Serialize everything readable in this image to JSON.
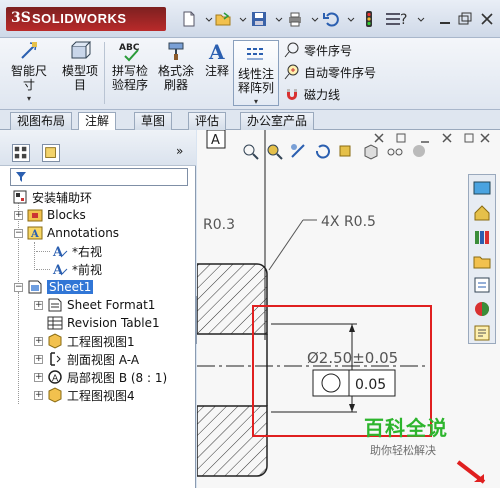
{
  "app": {
    "brand_ds": "3S",
    "brand_name": "SOLIDWORKS"
  },
  "ribbon": {
    "smart_dim_label": "智能尺寸",
    "model_items_label": "模型项目",
    "spell_check_label": "拼写检验程序",
    "format_painter_label": "格式涂刷器",
    "note_label": "注释",
    "linear_note_label": "线性注释阵列",
    "balloon_label": "零件序号",
    "auto_balloon_label": "自动零件序号",
    "magnetic_line_label": "磁力线",
    "abc_glyph": "ABC",
    "note_glyph": "A"
  },
  "tabs": [
    "视图布局",
    "注解",
    "草图",
    "评估",
    "办公室产品"
  ],
  "tabs_active_index": 1,
  "tree": {
    "root": "安装辅助环",
    "blocks": "Blocks",
    "annotations": "Annotations",
    "right_view": "*右视",
    "front_view": "*前视",
    "sheet1": "Sheet1",
    "sheet_format": "Sheet Format1",
    "revision_table": "Revision Table1",
    "drawing_view1": "工程图视图1",
    "section_view": "剖面视图 A-A",
    "detail_view": "局部视图 B (8 : 1)",
    "drawing_view4": "工程图视图4"
  },
  "drawing": {
    "r03": "R0.3",
    "r05": "4X R0.5",
    "diameter": "Ø2.50±0.05",
    "tolerance": "0.05",
    "datum": "A"
  },
  "watermark": {
    "title": "百科全说",
    "subtitle": "助你轻松解决"
  },
  "colors": {
    "accent": "#3176d6",
    "watermark_green": "#2db52d",
    "callout_red": "#e02020"
  }
}
